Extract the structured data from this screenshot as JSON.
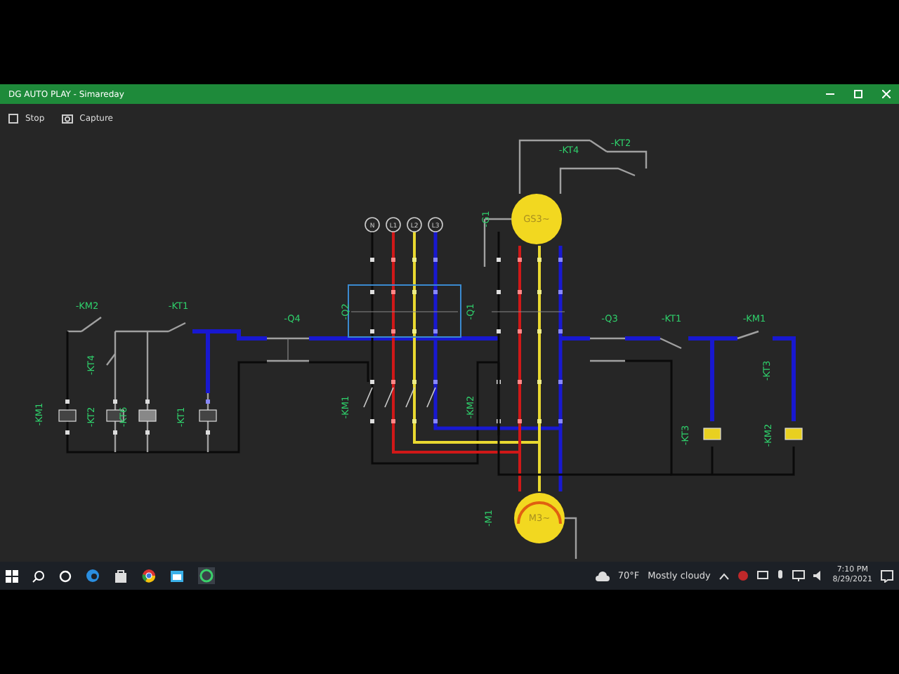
{
  "window": {
    "title": "DG AUTO PLAY - Simareday"
  },
  "toolbar": [
    {
      "kind": "stop",
      "label": "Stop"
    },
    {
      "kind": "capture",
      "label": "Capture"
    }
  ],
  "diagram": {
    "terminals": [
      "N",
      "L1",
      "L2",
      "L3"
    ],
    "machines": [
      {
        "kind": "generator",
        "label": "GS3~"
      },
      {
        "kind": "motor",
        "label": "M3~"
      }
    ],
    "labels": [
      "-KM2",
      "-KT1",
      "-Q4",
      "-KT4",
      "-KM1",
      "-KT2",
      "-KT6",
      "-KT1",
      "-Q2",
      "-Q1",
      "-G1",
      "-KT4",
      "-KT2",
      "-Q3",
      "-KT1",
      "-KM1",
      "-KT3",
      "-KM1",
      "-KM2",
      "-M1",
      "-KT3",
      "-KM2"
    ]
  },
  "taskbar": {
    "weather": {
      "temperature": "70°F",
      "condition": "Mostly cloudy"
    },
    "time": "7:10 PM",
    "date": "8/29/2021"
  }
}
